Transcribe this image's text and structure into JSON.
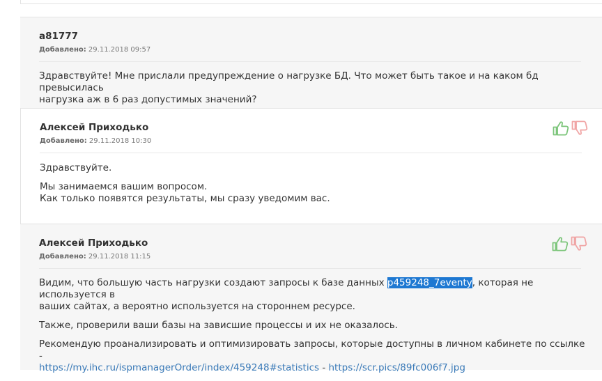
{
  "posts": [
    {
      "author": "a81777",
      "added_label": "Добавлено:",
      "date": "29.11.2018 09:57",
      "lines": [
        "Здравствуйте! Мне прислали предупреждение о нагрузке БД. Что может быть такое и на каком бд превысилась",
        "нагрузка аж в 6 раз допустимых значений?"
      ]
    },
    {
      "author": "Алексей Приходько",
      "added_label": "Добавлено:",
      "date": "29.11.2018 10:30",
      "greeting": "Здравствуйте.",
      "lines": [
        "Мы занимаемся вашим вопросом.",
        "Как только появятся результаты, мы сразу уведомим вас."
      ]
    },
    {
      "author": "Алексей Приходько",
      "added_label": "Добавлено:",
      "date": "29.11.2018 11:15",
      "p1_before": "Видим, что большую часть нагрузки создают запросы к базе данных ",
      "p1_highlight": "p459248_7eventy",
      "p1_after": ", которая не используется в",
      "p1_line2": "ваших сайтах, а вероятно используется на стороннем ресурсе.",
      "p2": "Также, проверили ваши базы на зависшие процессы и их не оказалось.",
      "p3_line1": "Рекомендую проанализировать и оптимизировать запросы, которые доступны в личном кабинете по ссылке -",
      "link1": "https://my.ihc.ru/ispmanagerOrder/index/459248#statistics",
      "link_sep": " - ",
      "link2": "https://scr.pics/89fc006f7.jpg"
    }
  ],
  "colors": {
    "like": "#7cc57a",
    "dislike": "#f0a5a5",
    "link": "#3a7ab8",
    "highlight": "#1e78d2"
  },
  "icons": {
    "like": "thumbs-up-icon",
    "dislike": "thumbs-down-icon"
  }
}
